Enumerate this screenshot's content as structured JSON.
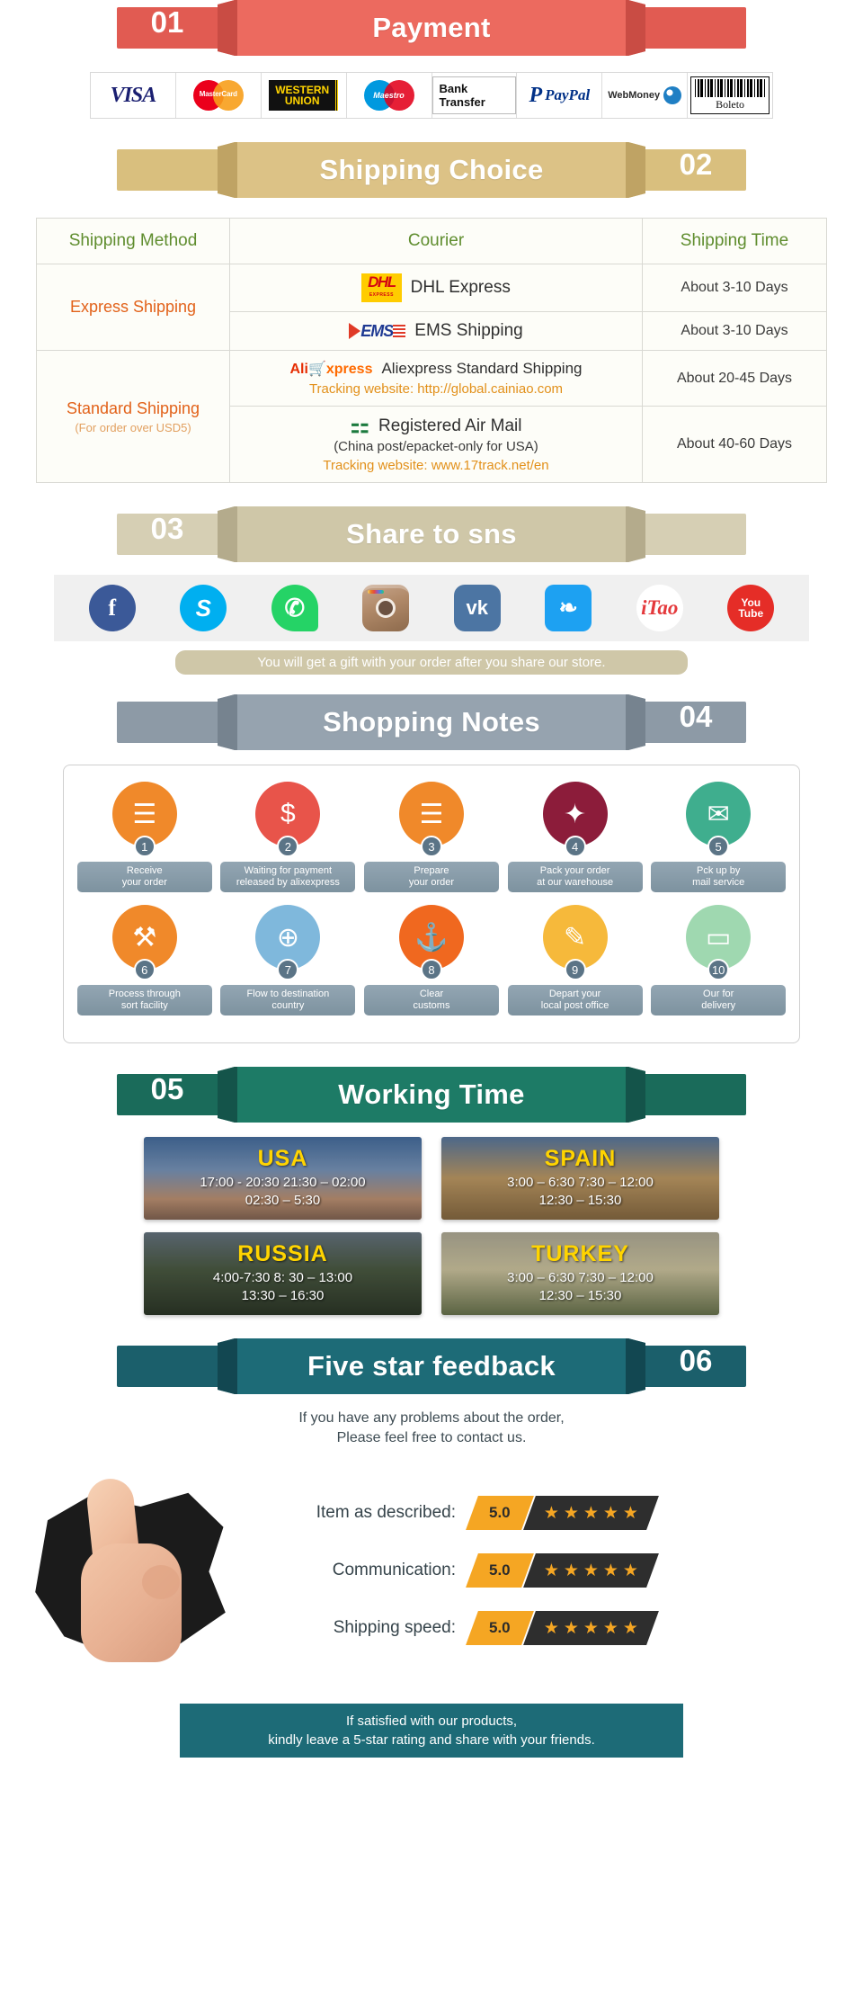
{
  "sections": {
    "payment": {
      "number": "01",
      "title": "Payment"
    },
    "shipping": {
      "number": "02",
      "title": "Shipping Choice"
    },
    "share": {
      "number": "03",
      "title": "Share to sns"
    },
    "notes": {
      "number": "04",
      "title": "Shopping Notes"
    },
    "working": {
      "number": "05",
      "title": "Working Time"
    },
    "feedback": {
      "number": "06",
      "title": "Five star feedback"
    }
  },
  "payment_methods": [
    {
      "name": "visa-logo",
      "label": "VISA"
    },
    {
      "name": "mastercard-logo",
      "label": "MasterCard"
    },
    {
      "name": "western-union-logo",
      "label": "WESTERN",
      "label2": "UNION"
    },
    {
      "name": "maestro-logo",
      "label": "Maestro"
    },
    {
      "name": "bank-transfer-logo",
      "label": "Bank Transfer"
    },
    {
      "name": "paypal-logo",
      "label": "PayPal"
    },
    {
      "name": "webmoney-logo",
      "label": "WebMoney"
    },
    {
      "name": "boleto-logo",
      "label": "Boleto"
    }
  ],
  "shipping_table": {
    "headers": [
      "Shipping Method",
      "Courier",
      "Shipping Time"
    ],
    "rows": [
      {
        "method": "Express Shipping",
        "method_sub": "",
        "couriers": [
          {
            "logo": "dhl",
            "name": "DHL Express",
            "note": "",
            "tracking": "",
            "time": "About 3-10 Days"
          },
          {
            "logo": "ems",
            "name": "EMS Shipping",
            "note": "",
            "tracking": "",
            "time": "About 3-10 Days"
          }
        ]
      },
      {
        "method": "Standard Shipping",
        "method_sub": "(For order over USD5)",
        "couriers": [
          {
            "logo": "aliexpress",
            "name": "Aliexpress Standard Shipping",
            "note": "",
            "tracking": "Tracking website: http://global.cainiao.com",
            "time": "About 20-45 Days"
          },
          {
            "logo": "chinapost",
            "name": "Registered Air Mail",
            "note": "(China post/epacket-only for USA)",
            "tracking": "Tracking website: www.17track.net/en",
            "time": "About 40-60 Days"
          }
        ]
      }
    ]
  },
  "social": [
    {
      "name": "facebook-icon",
      "label": "f"
    },
    {
      "name": "skype-icon",
      "label": "S"
    },
    {
      "name": "whatsapp-icon",
      "label": "✆"
    },
    {
      "name": "instagram-icon",
      "label": ""
    },
    {
      "name": "vk-icon",
      "label": "vk"
    },
    {
      "name": "twitter-icon",
      "label": "❧"
    },
    {
      "name": "itao-icon",
      "label": "iTao"
    },
    {
      "name": "youtube-icon",
      "label": "You"
    }
  ],
  "share_note": "You will get a gift with your order after you share our store.",
  "shopping_notes": [
    {
      "num": "1",
      "label": "Receive\nyour order",
      "icon": "☰",
      "color": "#f0892a"
    },
    {
      "num": "2",
      "label": "Waiting for payment\nreleased by alixexpress",
      "icon": "$",
      "color": "#e8544a"
    },
    {
      "num": "3",
      "label": "Prepare\nyour order",
      "icon": "☰",
      "color": "#f0892a"
    },
    {
      "num": "4",
      "label": "Pack your order\nat our warehouse",
      "icon": "✦",
      "color": "#8c1c3a"
    },
    {
      "num": "5",
      "label": "Pck up by\nmail service",
      "icon": "✉",
      "color": "#3fae8e"
    },
    {
      "num": "6",
      "label": "Process through\nsort facility",
      "icon": "⚒",
      "color": "#f0892a"
    },
    {
      "num": "7",
      "label": "Flow to destination\ncountry",
      "icon": "⊕",
      "color": "#7fb8dc"
    },
    {
      "num": "8",
      "label": "Clear\ncustoms",
      "icon": "⚓",
      "color": "#f0681f"
    },
    {
      "num": "9",
      "label": "Depart your\nlocal post office",
      "icon": "✎",
      "color": "#f6b93b"
    },
    {
      "num": "10",
      "label": "Our for\ndelivery",
      "icon": "▭",
      "color": "#9fd8b0"
    }
  ],
  "working_time": [
    {
      "country": "USA",
      "times": "17:00  -  20:30   21:30  –  02:00\n02:30  –  5:30",
      "bg": "bg-usa"
    },
    {
      "country": "SPAIN",
      "times": "3:00  –  6:30   7:30  –  12:00\n12:30  –  15:30",
      "bg": "bg-spain"
    },
    {
      "country": "RUSSIA",
      "times": "4:00-7:30   8: 30  –  13:00\n13:30  –  16:30",
      "bg": "bg-russia"
    },
    {
      "country": "TURKEY",
      "times": "3:00  –  6:30   7:30  –  12:00\n12:30  –  15:30",
      "bg": "bg-turkey"
    }
  ],
  "feedback": {
    "intro_line1": "If you have any problems about the order,",
    "intro_line2": "Please feel free to contact us.",
    "ratings": [
      {
        "label": "Item as described:",
        "score": "5.0",
        "stars": 5
      },
      {
        "label": "Communication:",
        "score": "5.0",
        "stars": 5
      },
      {
        "label": "Shipping speed:",
        "score": "5.0",
        "stars": 5
      }
    ],
    "footer_line1": "If satisfied with our products,",
    "footer_line2": "kindly leave a 5-star rating and share with your friends."
  },
  "colors": {
    "payment_red": "#ec6a5f",
    "shipping_gold": "#dcc286",
    "share_sand": "#cfc7a8",
    "notes_slate": "#96a3af",
    "working_green": "#1d7b66",
    "feedback_teal": "#1d6b77",
    "star_amber": "#f5a623"
  }
}
